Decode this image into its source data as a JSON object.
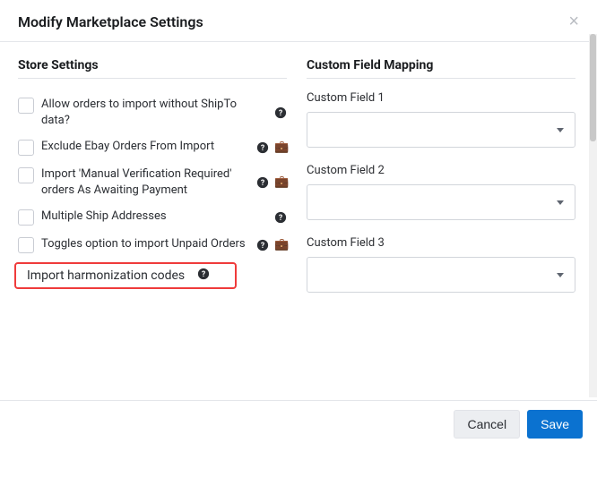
{
  "header": {
    "title": "Modify Marketplace Settings",
    "close_label": "×"
  },
  "store_settings": {
    "heading": "Store Settings",
    "items": [
      {
        "label": "Allow orders to import without ShipTo data?",
        "checked": false,
        "help": true,
        "extra": false
      },
      {
        "label": "Exclude Ebay Orders From Import",
        "checked": false,
        "help": true,
        "extra": true
      },
      {
        "label": "Import 'Manual Verification Required' orders As Awaiting Payment",
        "checked": false,
        "help": true,
        "extra": true
      },
      {
        "label": "Multiple Ship Addresses",
        "checked": false,
        "help": true,
        "extra": false
      },
      {
        "label": "Toggles option to import Unpaid Orders",
        "checked": false,
        "help": true,
        "extra": true
      },
      {
        "label": "Import harmonization codes",
        "checked": true,
        "help": true,
        "extra": false,
        "highlight": true
      }
    ]
  },
  "custom_mapping": {
    "heading": "Custom Field Mapping",
    "fields": [
      {
        "label": "Custom Field 1",
        "value": ""
      },
      {
        "label": "Custom Field 2",
        "value": ""
      },
      {
        "label": "Custom Field 3",
        "value": ""
      }
    ]
  },
  "footer": {
    "cancel": "Cancel",
    "save": "Save"
  },
  "icons": {
    "suitcase": "💼"
  }
}
